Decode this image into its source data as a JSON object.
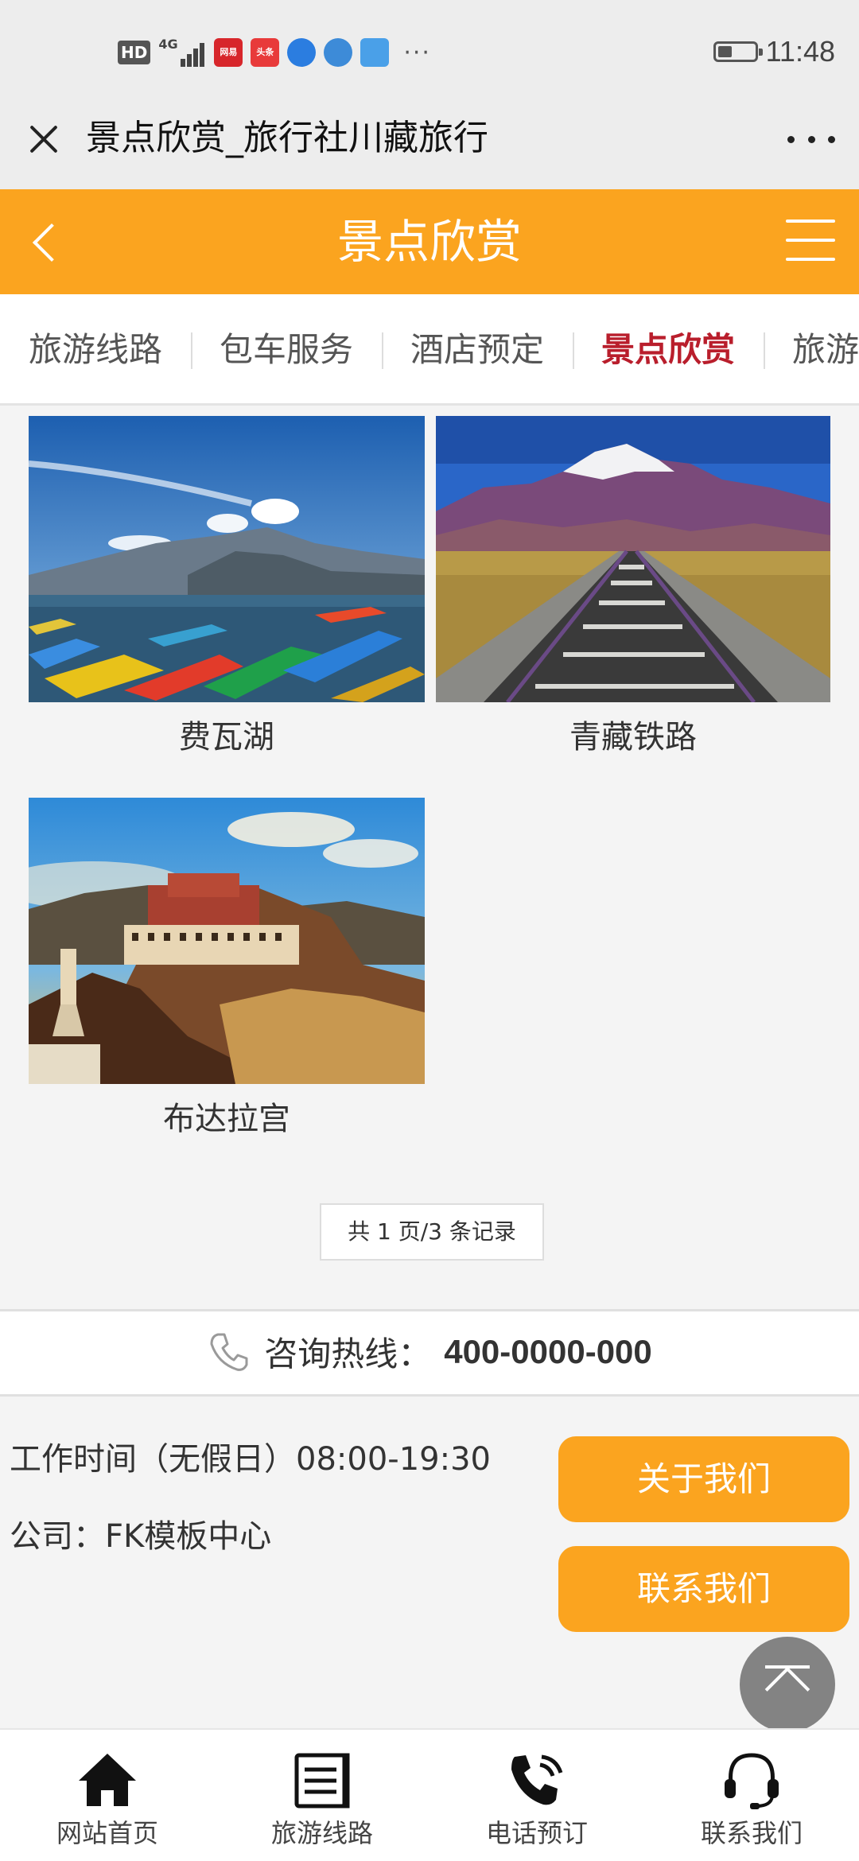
{
  "status_bar": {
    "hd": "HD",
    "network": "4G",
    "apps": [
      {
        "name": "netease-news-icon",
        "label": "网易",
        "color": "#d7262b"
      },
      {
        "name": "toutiao-icon",
        "label": "头条",
        "color": "#e83a3a"
      },
      {
        "name": "app-blue-icon",
        "label": "",
        "color": "#2b7de0"
      },
      {
        "name": "app-sphere-icon",
        "label": "",
        "color": "#3d8bd8"
      },
      {
        "name": "cloud-app-icon",
        "label": "",
        "color": "#4aa0e8"
      }
    ],
    "more": "···",
    "battery_level": 0.35,
    "time": "11:48"
  },
  "browser": {
    "title": "景点欣赏_旅行社川藏旅行"
  },
  "header": {
    "title": "景点欣赏",
    "accent_color": "#fba41f"
  },
  "nav": {
    "tabs": [
      {
        "label": "旅游线路",
        "active": false
      },
      {
        "label": "包车服务",
        "active": false
      },
      {
        "label": "酒店预定",
        "active": false
      },
      {
        "label": "景点欣赏",
        "active": true
      },
      {
        "label": "旅游",
        "active": false
      }
    ],
    "active_color": "#b91e2c"
  },
  "gallery": {
    "items": [
      {
        "caption": "费瓦湖"
      },
      {
        "caption": "青藏铁路"
      },
      {
        "caption": "布达拉宫"
      }
    ]
  },
  "pager": {
    "text": "共 1 页/3 条记录"
  },
  "hotline": {
    "label": "咨询热线：",
    "number": "400-0000-000"
  },
  "footer": {
    "work_time": "工作时间（无假日）08:00-19:30",
    "company": "公司：FK模板中心",
    "about_button": "关于我们",
    "contact_button": "联系我们"
  },
  "bottom_nav": {
    "items": [
      {
        "label": "网站首页",
        "icon": "home-icon"
      },
      {
        "label": "旅游线路",
        "icon": "document-icon"
      },
      {
        "label": "电话预订",
        "icon": "phone-ringing-icon"
      },
      {
        "label": "联系我们",
        "icon": "headset-icon"
      }
    ]
  }
}
